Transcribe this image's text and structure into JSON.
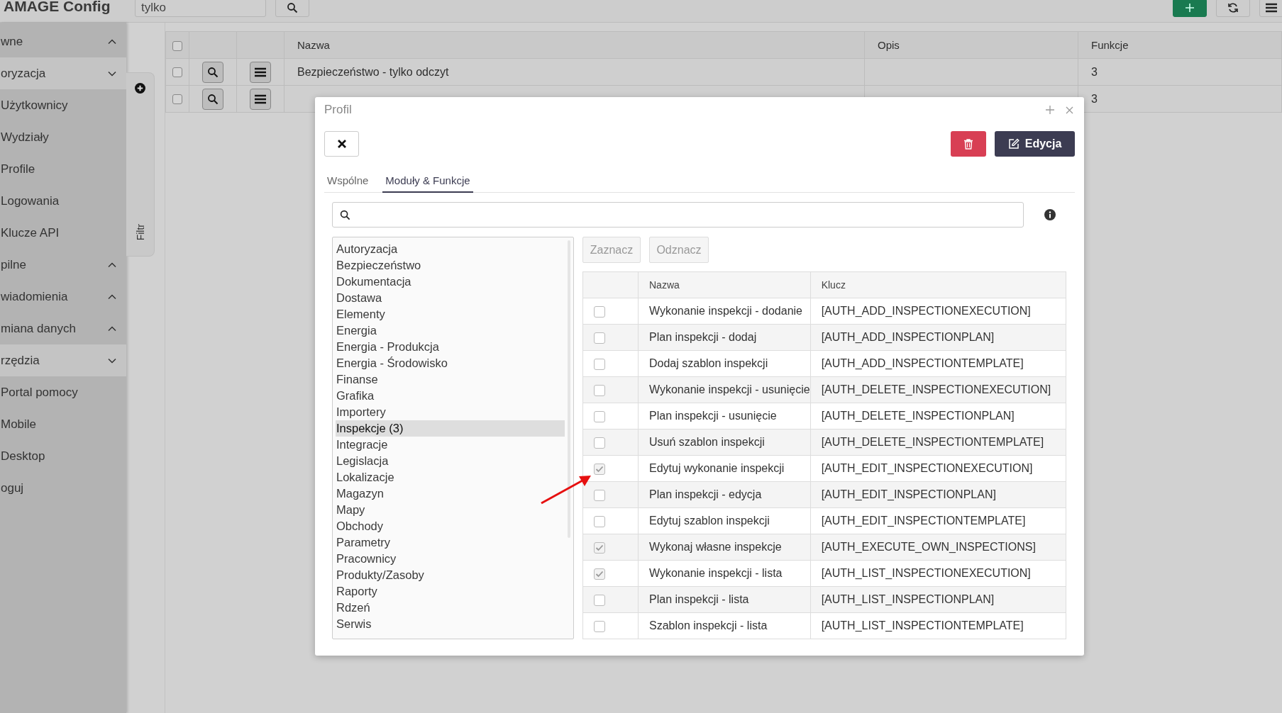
{
  "app": {
    "title": "AMAGE Config"
  },
  "top_bar": {
    "search": {
      "value": "tylko"
    }
  },
  "sidebar": {
    "items": [
      {
        "label": "wne",
        "kind": "group",
        "expanded": false
      },
      {
        "label": "oryzacja",
        "kind": "group",
        "expanded": true,
        "children": [
          {
            "label": "Użytkownicy"
          },
          {
            "label": "Wydziały"
          },
          {
            "label": "Profile"
          },
          {
            "label": "Logowania"
          },
          {
            "label": "Klucze API"
          }
        ]
      },
      {
        "label": "pilne",
        "kind": "group",
        "expanded": false
      },
      {
        "label": "wiadomienia",
        "kind": "group",
        "expanded": false
      },
      {
        "label": "miana danych",
        "kind": "group",
        "expanded": false
      },
      {
        "label": "rzędzia",
        "kind": "group",
        "expanded": true,
        "children": [
          {
            "label": "Portal pomocy"
          },
          {
            "label": "Mobile"
          },
          {
            "label": "Desktop"
          }
        ]
      },
      {
        "label": "oguj",
        "kind": "link",
        "expanded": false
      }
    ]
  },
  "filter_panel": {
    "label": "Filtr"
  },
  "table": {
    "select_all": {
      "checked": false
    },
    "columns": [
      "Nazwa",
      "Opis",
      "Funkcje"
    ],
    "rows": [
      {
        "checked": false,
        "name": "Bezpieczeństwo - tylko odczyt",
        "functions": "3"
      },
      {
        "checked": false,
        "functions": "3"
      }
    ]
  },
  "dialog": {
    "title": "Profil",
    "edit_button": "Edycja",
    "tabs": [
      {
        "label": "Wspólne",
        "selected": false
      },
      {
        "label": "Moduły & Funkcje",
        "selected": true
      }
    ],
    "modules": [
      {
        "label": "Autoryzacja",
        "selected": false
      },
      {
        "label": "Bezpieczeństwo",
        "selected": false
      },
      {
        "label": "Dokumentacja",
        "selected": false
      },
      {
        "label": "Dostawa",
        "selected": false
      },
      {
        "label": "Elementy",
        "selected": false
      },
      {
        "label": "Energia",
        "selected": false
      },
      {
        "label": "Energia - Produkcja",
        "selected": false
      },
      {
        "label": "Energia - Środowisko",
        "selected": false
      },
      {
        "label": "Finanse",
        "selected": false
      },
      {
        "label": "Grafika",
        "selected": false
      },
      {
        "label": "Importery",
        "selected": false
      },
      {
        "label": "Inspekcje (3)",
        "selected": true
      },
      {
        "label": "Integracje",
        "selected": false
      },
      {
        "label": "Legislacja",
        "selected": false
      },
      {
        "label": "Lokalizacje",
        "selected": false
      },
      {
        "label": "Magazyn",
        "selected": false
      },
      {
        "label": "Mapy",
        "selected": false
      },
      {
        "label": "Obchody",
        "selected": false
      },
      {
        "label": "Parametry",
        "selected": false
      },
      {
        "label": "Pracownicy",
        "selected": false
      },
      {
        "label": "Produkty/Zasoby",
        "selected": false
      },
      {
        "label": "Raporty",
        "selected": false
      },
      {
        "label": "Rdzeń",
        "selected": false
      },
      {
        "label": "Serwis",
        "selected": false
      }
    ],
    "select_buttons": [
      "Zaznacz",
      "Odznacz"
    ],
    "functions": {
      "columns": [
        "Nazwa",
        "Klucz"
      ],
      "rows": [
        {
          "checked": false,
          "name": "Wykonanie inspekcji - dodanie",
          "key": "[AUTH_ADD_INSPECTIONEXECUTION]"
        },
        {
          "checked": false,
          "name": "Plan inspekcji - dodaj",
          "key": "[AUTH_ADD_INSPECTIONPLAN]"
        },
        {
          "checked": false,
          "name": "Dodaj szablon inspekcji",
          "key": "[AUTH_ADD_INSPECTIONTEMPLATE]"
        },
        {
          "checked": false,
          "name": "Wykonanie inspekcji - usunięcie",
          "key": "[AUTH_DELETE_INSPECTIONEXECUTION]"
        },
        {
          "checked": false,
          "name": "Plan inspekcji - usunięcie",
          "key": "[AUTH_DELETE_INSPECTIONPLAN]"
        },
        {
          "checked": false,
          "name": "Usuń szablon inspekcji",
          "key": "[AUTH_DELETE_INSPECTIONTEMPLATE]"
        },
        {
          "checked": true,
          "name": "Edytuj wykonanie inspekcji",
          "key": "[AUTH_EDIT_INSPECTIONEXECUTION]"
        },
        {
          "checked": false,
          "name": "Plan inspekcji - edycja",
          "key": "[AUTH_EDIT_INSPECTIONPLAN]"
        },
        {
          "checked": false,
          "name": "Edytuj szablon inspekcji",
          "key": "[AUTH_EDIT_INSPECTIONTEMPLATE]"
        },
        {
          "checked": true,
          "name": "Wykonaj własne inspekcje",
          "key": "[AUTH_EXECUTE_OWN_INSPECTIONS]"
        },
        {
          "checked": true,
          "name": "Wykonanie inspekcji - lista",
          "key": "[AUTH_LIST_INSPECTIONEXECUTION]"
        },
        {
          "checked": false,
          "name": "Plan inspekcji - lista",
          "key": "[AUTH_LIST_INSPECTIONPLAN]"
        },
        {
          "checked": false,
          "name": "Szablon inspekcji - lista",
          "key": "[AUTH_LIST_INSPECTIONTEMPLATE]"
        }
      ]
    }
  }
}
